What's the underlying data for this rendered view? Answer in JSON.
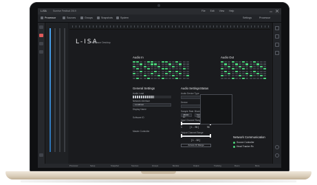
{
  "window": {
    "app_title": "L-ISA",
    "file_title": "Sunrise Festival 2019",
    "menu": [
      "File",
      "Edit",
      "View",
      "Help"
    ]
  },
  "toolbar": {
    "tabs": [
      {
        "label": "Processor",
        "active": true
      },
      {
        "label": "Sources",
        "active": false
      },
      {
        "label": "Groups",
        "active": false
      },
      {
        "label": "Snapshots",
        "active": false
      },
      {
        "label": "System",
        "active": false
      }
    ],
    "right": [
      "Settings",
      "Processor"
    ]
  },
  "main": {
    "logo": "L-ISA",
    "logo_sub": "Processor Desktop",
    "audio_in": {
      "title": "Audio In",
      "rows": 8,
      "cols": 16,
      "active_cells": [
        [
          0,
          0
        ],
        [
          0,
          1
        ],
        [
          0,
          4
        ],
        [
          0,
          5
        ],
        [
          0,
          8
        ],
        [
          0,
          9
        ],
        [
          0,
          12
        ],
        [
          1,
          2
        ],
        [
          1,
          5
        ],
        [
          1,
          6
        ],
        [
          1,
          10
        ],
        [
          1,
          13
        ],
        [
          2,
          0
        ],
        [
          2,
          3
        ],
        [
          2,
          7
        ],
        [
          2,
          11
        ],
        [
          3,
          1
        ],
        [
          3,
          4
        ],
        [
          3,
          8
        ],
        [
          3,
          9
        ],
        [
          3,
          14
        ],
        [
          4,
          2
        ],
        [
          4,
          6
        ],
        [
          4,
          10
        ],
        [
          4,
          12
        ],
        [
          5,
          0
        ],
        [
          5,
          5
        ],
        [
          5,
          9
        ],
        [
          5,
          13
        ],
        [
          6,
          3
        ],
        [
          6,
          7
        ],
        [
          6,
          11
        ],
        [
          6,
          15
        ],
        [
          7,
          1
        ],
        [
          7,
          4
        ],
        [
          7,
          8
        ],
        [
          7,
          12
        ]
      ]
    },
    "audio_out": {
      "title": "Audio Out",
      "rows": 8,
      "cols": 13,
      "active_cells": [
        [
          0,
          0
        ],
        [
          0,
          3
        ],
        [
          0,
          6
        ],
        [
          0,
          9
        ],
        [
          1,
          1
        ],
        [
          1,
          4
        ],
        [
          1,
          7
        ],
        [
          1,
          10
        ],
        [
          2,
          2
        ],
        [
          2,
          5
        ],
        [
          2,
          8
        ],
        [
          2,
          11
        ],
        [
          3,
          0
        ],
        [
          3,
          3
        ],
        [
          3,
          6
        ],
        [
          3,
          12
        ],
        [
          4,
          1
        ],
        [
          4,
          4
        ],
        [
          4,
          9
        ],
        [
          5,
          2
        ],
        [
          5,
          7
        ],
        [
          5,
          10
        ],
        [
          6,
          0
        ],
        [
          6,
          5
        ],
        [
          6,
          8
        ],
        [
          6,
          11
        ],
        [
          7,
          3
        ],
        [
          7,
          6
        ],
        [
          7,
          12
        ]
      ]
    },
    "general_settings": {
      "title": "General Settings",
      "audio_load_label": "Audio Load",
      "audio_load_fraction": 0.55,
      "network_interface_label": "Network Interface",
      "network_interface_value": "Localhost",
      "display_name_label": "Display Name",
      "software_id_label": "Software ID",
      "master_controller_label": "Master Controller"
    },
    "audio_settings": {
      "title": "Audio Settings",
      "audio_device_type_label": "Audio Device Type",
      "device_label": "Device",
      "sample_rate_label": "Sample Rate",
      "sample_rate_value": "48000 Hz",
      "block_size_label": "Block Size",
      "block_size_value": "512 (10.7 ms)",
      "input_channel_label": "Input Channel Range",
      "input_range_text": "[ 1 .. 96 ]",
      "input_min": "1",
      "input_max": "96",
      "output_channel_label": "Output Channel Range",
      "output_range_text": "[ 1 .. 32 ]",
      "test_button": "Access IO Range"
    },
    "status": {
      "title": "Status"
    },
    "network_communication": {
      "title": "Network Communication",
      "items": [
        {
          "label": "Source Controller",
          "status_color": "#4bd37a"
        },
        {
          "label": "Head Tracker Rx",
          "status_color": "#4bd37a"
        }
      ]
    }
  },
  "bottom_bar": {
    "items": [
      "Processor",
      "Setup",
      "Snapshot",
      "Sources",
      "Groups",
      "Monitor",
      "Output",
      "Tracking",
      "Room",
      "More"
    ]
  },
  "colors": {
    "accent_green": "#4bd37a",
    "fader_blue": "#4aa3f0",
    "mute_red": "#e05a5a"
  }
}
